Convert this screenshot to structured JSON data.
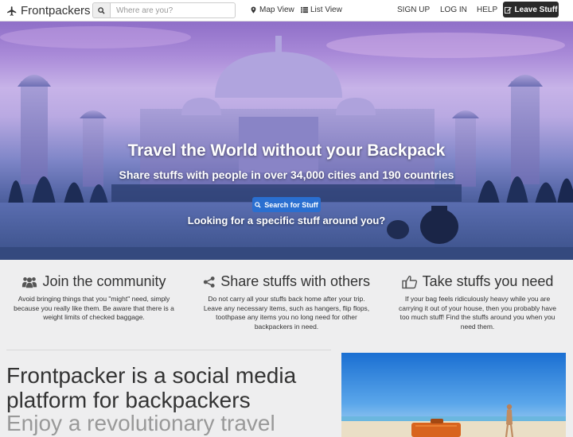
{
  "navbar": {
    "brand": "Frontpackers",
    "search_placeholder": "Where are you?",
    "map_view": "Map View",
    "list_view": "List View",
    "sign_up": "SIGN UP",
    "log_in": "LOG IN",
    "help": "HELP",
    "leave_stuff": "Leave Stuff"
  },
  "hero": {
    "title": "Travel the World without your Backpack",
    "subtitle": "Share stuffs with people in over 34,000 cities and 190 countries",
    "button": "Search for Stuff",
    "question": "Looking for a specific stuff around you?"
  },
  "features": [
    {
      "title": "Join the community",
      "icon": "users-icon",
      "text": "Avoid bringing things that you \"might\" need, simply because you really like them. Be aware that there is a weight limits of checked baggage."
    },
    {
      "title": "Share stuffs with others",
      "icon": "share-icon",
      "text": "Do not carry all your stuffs back home after your trip. Leave any necessary items, such as hangers, flip flops, toothpase any items you no long need for other backpackers in need."
    },
    {
      "title": "Take stuffs you need",
      "icon": "thumbs-up-icon",
      "text": "If your bag feels ridiculously heavy while you are carrying it out of your house, then you probably have too much stuff! Find the stuffs around you when you need them."
    }
  ],
  "promo": {
    "line1": "Frontpacker is a social media platform for backpackers",
    "line2": "Enjoy a revolutionary travel"
  }
}
